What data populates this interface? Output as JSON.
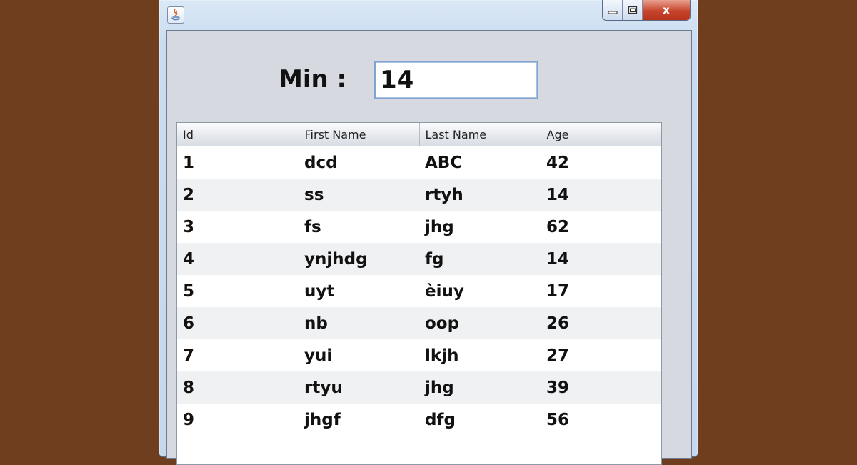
{
  "window": {
    "controls": {
      "minimize_icon": "minimize-icon",
      "maximize_icon": "maximize-icon",
      "close_icon": "close-icon",
      "close_glyph": "x"
    }
  },
  "filter": {
    "label": "Min :",
    "value": "14"
  },
  "table": {
    "columns": [
      "Id",
      "First Name",
      "Last Name",
      "Age"
    ],
    "rows": [
      [
        "1",
        "dcd",
        "ABC",
        "42"
      ],
      [
        "2",
        "ss",
        "rtyh",
        "14"
      ],
      [
        "3",
        "fs",
        "jhg",
        "62"
      ],
      [
        "4",
        "ynjhdg",
        "fg",
        "14"
      ],
      [
        "5",
        "uyt",
        "èiuy",
        "17"
      ],
      [
        "6",
        "nb",
        "oop",
        "26"
      ],
      [
        "7",
        "yui",
        "lkjh",
        "27"
      ],
      [
        "8",
        "rtyu",
        "jhg",
        "39"
      ],
      [
        "9",
        "jhgf",
        "dfg",
        "56"
      ]
    ]
  },
  "colors": {
    "desktop": "#6f3e1f",
    "close_button": "#c7452c",
    "panel": "#d6d9df"
  }
}
